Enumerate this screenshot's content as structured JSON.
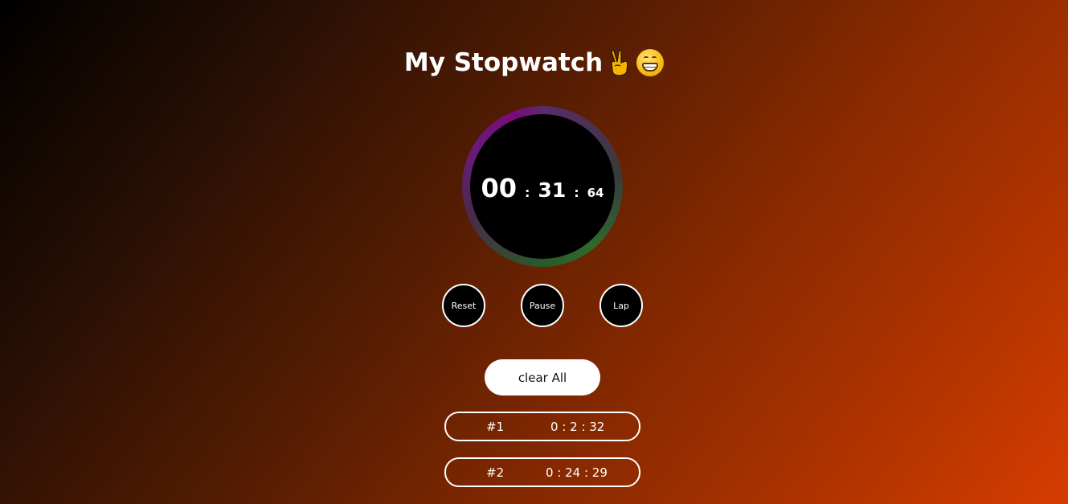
{
  "header": {
    "title": "My Stopwatch",
    "icons": [
      "victory-hand-emoji",
      "grinning-face-emoji"
    ]
  },
  "stopwatch": {
    "minutes": "00",
    "seconds": "31",
    "milliseconds": "64",
    "separator": ":"
  },
  "controls": {
    "reset_label": "Reset",
    "pause_label": "Pause",
    "lap_label": "Lap"
  },
  "clear_label": "clear All",
  "laps": [
    {
      "number": "#1",
      "time": "0 : 2 : 32"
    },
    {
      "number": "#2",
      "time": "0 : 24 : 29"
    }
  ],
  "colors": {
    "ring_purple": "#7a0a7a",
    "ring_green": "#2e6a2e",
    "background_end": "#d63d00"
  }
}
